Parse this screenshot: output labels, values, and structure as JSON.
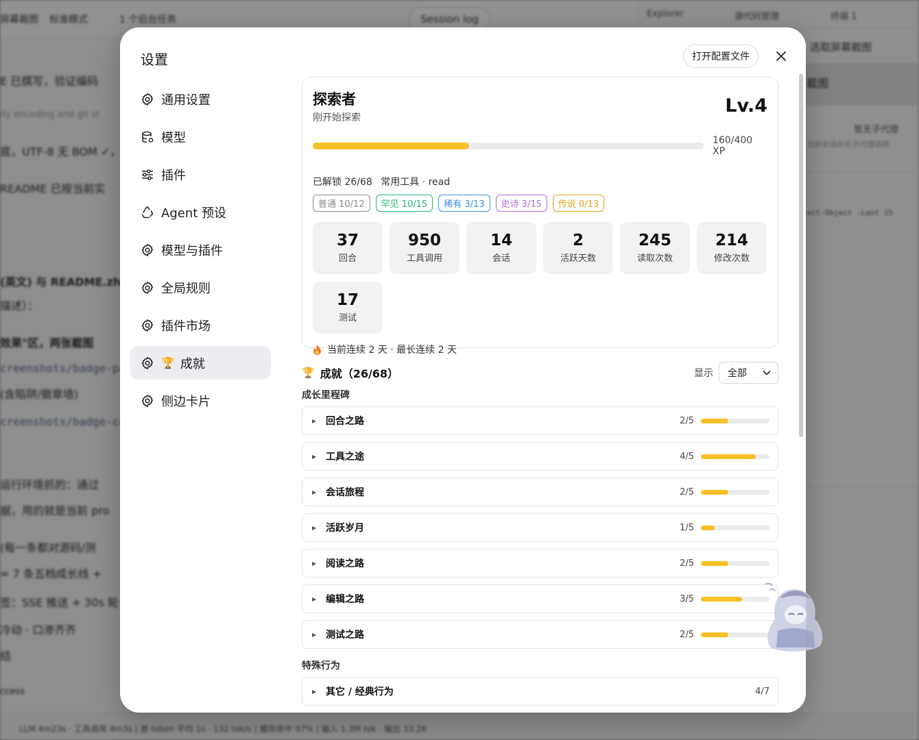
{
  "background": {
    "title": "屏幕截图",
    "mode": "标准模式",
    "tasks": "1 个后台任务",
    "session_log": "Session log",
    "tabs": [
      "Explorer",
      "源代码管理",
      "终端 1"
    ],
    "right_sub": "选取屏幕截图",
    "right_selected": "截图",
    "right_line1": "暂无子代理",
    "right_line2": "当前会话尚无子代理调用",
    "right_code": "ect-Object -Last 15",
    "left_lines": [
      "E 已撰写，验证编码",
      "ify encoding and git st",
      "底，UTF-8 无 BOM ✓，",
      "README 已按当前实",
      "(英文) 与 README.zh",
      "描述）：",
      "效果\"区，两张截图",
      "creenshots/badge-pa",
      "(含陷阱/徽章墙)",
      "creenshots/badge-ca",
      "运行环境抓的：通过",
      "据，用的就是当前 pro",
      "(每一条都对源码/测",
      "= 7 条五档成长线 +",
      "签：SSE 推送 + 30s 轮",
      "冷动 · 口渗齐齐",
      "结",
      "ccess"
    ],
    "statusbar": "LLM 4m23s · 工具调用 4m3s  |  首 token 平均 1s · 132 tok/s  |  缓存命中 97%  |  输入 1.3M tok · 输出 33.2K"
  },
  "modal": {
    "title": "设置",
    "open_config": "打开配置文件",
    "nav": [
      {
        "label": "通用设置",
        "icon": "gear-icon"
      },
      {
        "label": "模型",
        "icon": "database-icon"
      },
      {
        "label": "插件",
        "icon": "sliders-icon"
      },
      {
        "label": "Agent 预设",
        "icon": "recycle-icon"
      },
      {
        "label": "模型与插件",
        "icon": "gear-icon"
      },
      {
        "label": "全局规则",
        "icon": "gear-icon"
      },
      {
        "label": "插件市场",
        "icon": "gear-icon"
      },
      {
        "label": "成就",
        "icon": "gear-icon",
        "emoji": "🏆"
      },
      {
        "label": "侧边卡片",
        "icon": "gear-icon"
      }
    ],
    "active_nav_index": 7
  },
  "profile": {
    "rank": "探索者",
    "subtitle": "刚开始探索",
    "level": "Lv.4",
    "xp_text": "160/400 XP",
    "xp_current": 160,
    "xp_max": 400,
    "unlocked": "已解锁 26/68",
    "common_tool": "常用工具 · read",
    "tags": [
      {
        "label": "普通 10/12",
        "color": "#8a8a8a"
      },
      {
        "label": "罕见 10/15",
        "color": "#22b573"
      },
      {
        "label": "稀有 3/13",
        "color": "#3b8ee8"
      },
      {
        "label": "史诗 3/15",
        "color": "#b26ae0"
      },
      {
        "label": "传说 0/13",
        "color": "#e3a21b"
      }
    ],
    "stats": [
      {
        "value": "37",
        "label": "回合"
      },
      {
        "value": "950",
        "label": "工具调用"
      },
      {
        "value": "14",
        "label": "会话"
      },
      {
        "value": "2",
        "label": "活跃天数"
      },
      {
        "value": "245",
        "label": "读取次数"
      },
      {
        "value": "214",
        "label": "修改次数"
      },
      {
        "value": "17",
        "label": "测试"
      }
    ],
    "streak": "当前连续 2 天 · 最长连续 2 天"
  },
  "achievements": {
    "trophy": "🏆",
    "title": "成就（26/68）",
    "filter_label": "显示",
    "filter_value": "全部",
    "milestones_title": "成长里程碑",
    "milestones": [
      {
        "name": "回合之路",
        "count": "2/5",
        "progress": 0.4
      },
      {
        "name": "工具之途",
        "count": "4/5",
        "progress": 0.8
      },
      {
        "name": "会话旅程",
        "count": "2/5",
        "progress": 0.4
      },
      {
        "name": "活跃岁月",
        "count": "1/5",
        "progress": 0.2
      },
      {
        "name": "阅读之路",
        "count": "2/5",
        "progress": 0.4
      },
      {
        "name": "编辑之路",
        "count": "3/5",
        "progress": 0.6
      },
      {
        "name": "测试之路",
        "count": "2/5",
        "progress": 0.4
      }
    ],
    "special_title": "特殊行为",
    "special": [
      {
        "name": "其它 / 经典行为",
        "count": "4/7"
      }
    ]
  },
  "colors": {
    "accent": "#f6c026",
    "active_nav_bg": "#ebedf1"
  }
}
